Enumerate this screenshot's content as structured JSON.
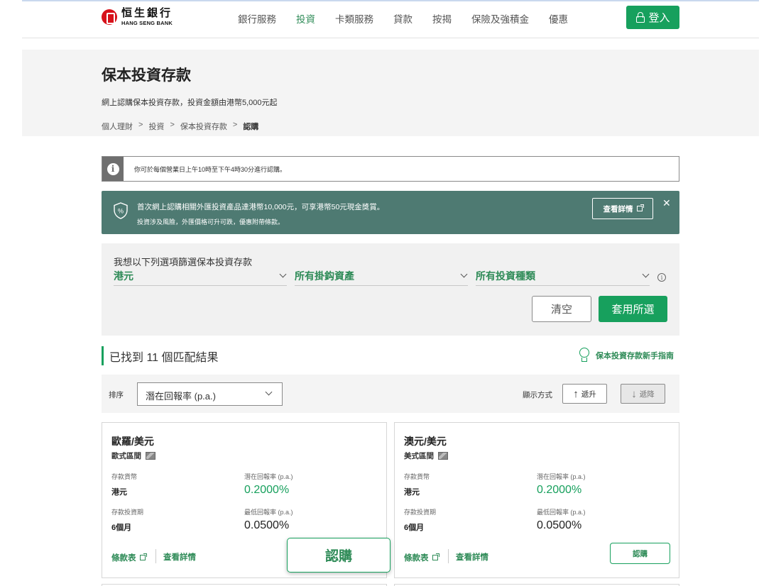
{
  "header": {
    "logo_cn": "恒生銀行",
    "logo_en": "HANG SENG BANK",
    "nav": [
      "銀行服務",
      "投資",
      "卡類服務",
      "貸款",
      "按揭",
      "保險及強積金",
      "優惠"
    ],
    "active_nav": "投資",
    "login_label": "登入"
  },
  "hero": {
    "title": "保本投資存款",
    "subtitle": "網上認購保本投資存款，投資金額由港幣5,000元起",
    "breadcrumb": [
      "個人理財",
      "投資",
      "保本投資存款",
      "認購"
    ]
  },
  "info_banner": {
    "text": "你可於每個營業日上午10時至下午4時30分進行認購。"
  },
  "promo": {
    "line1": "首次網上認購相關外匯投資產品達港幣10,000元，可享港幣50元現金獎賞。",
    "line2": "投資涉及風險，外匯價格可升可跌，優惠附帶條款。",
    "button_label": "查看詳情",
    "close_glyph": "✕"
  },
  "filter": {
    "label": "我想以下列選項篩選保本投資存款",
    "currency": "港元",
    "asset": "所有掛鈎資產",
    "type": "所有投資種類",
    "clear_label": "清空",
    "apply_label": "套用所選"
  },
  "results": {
    "count_text": "已找到 11 個匹配結果",
    "guide_label": "保本投資存款新手指南"
  },
  "sort": {
    "label": "排序",
    "selected": "潛在回報率 (p.a.)",
    "display_label": "顯示方式",
    "asc_label": "遞升",
    "desc_label": "遞降"
  },
  "cards": [
    {
      "title": "歐羅/美元",
      "subtitle": "歐式區間",
      "currency_key": "存款貨幣",
      "currency": "港元",
      "potential_key": "潛在回報率 (p.a.)",
      "potential": "0.2000%",
      "tenor_key": "存款投資期",
      "tenor": "6個月",
      "min_key": "最低回報率 (p.a.)",
      "min": "0.0500%",
      "terms_label": "條款表",
      "details_label": "查看詳情",
      "subscribe_label": "認購"
    },
    {
      "title": "澳元/美元",
      "subtitle": "美式區間",
      "currency_key": "存款貨幣",
      "currency": "港元",
      "potential_key": "潛在回報率 (p.a.)",
      "potential": "0.2000%",
      "tenor_key": "存款投資期",
      "tenor": "6個月",
      "min_key": "最低回報率 (p.a.)",
      "min": "0.0500%",
      "terms_label": "條款表",
      "details_label": "查看詳情",
      "subscribe_label": "認購"
    }
  ],
  "colors": {
    "brand_green": "#17a05d",
    "promo_bg": "#4e7a72",
    "logo_red": "#d7121b"
  }
}
